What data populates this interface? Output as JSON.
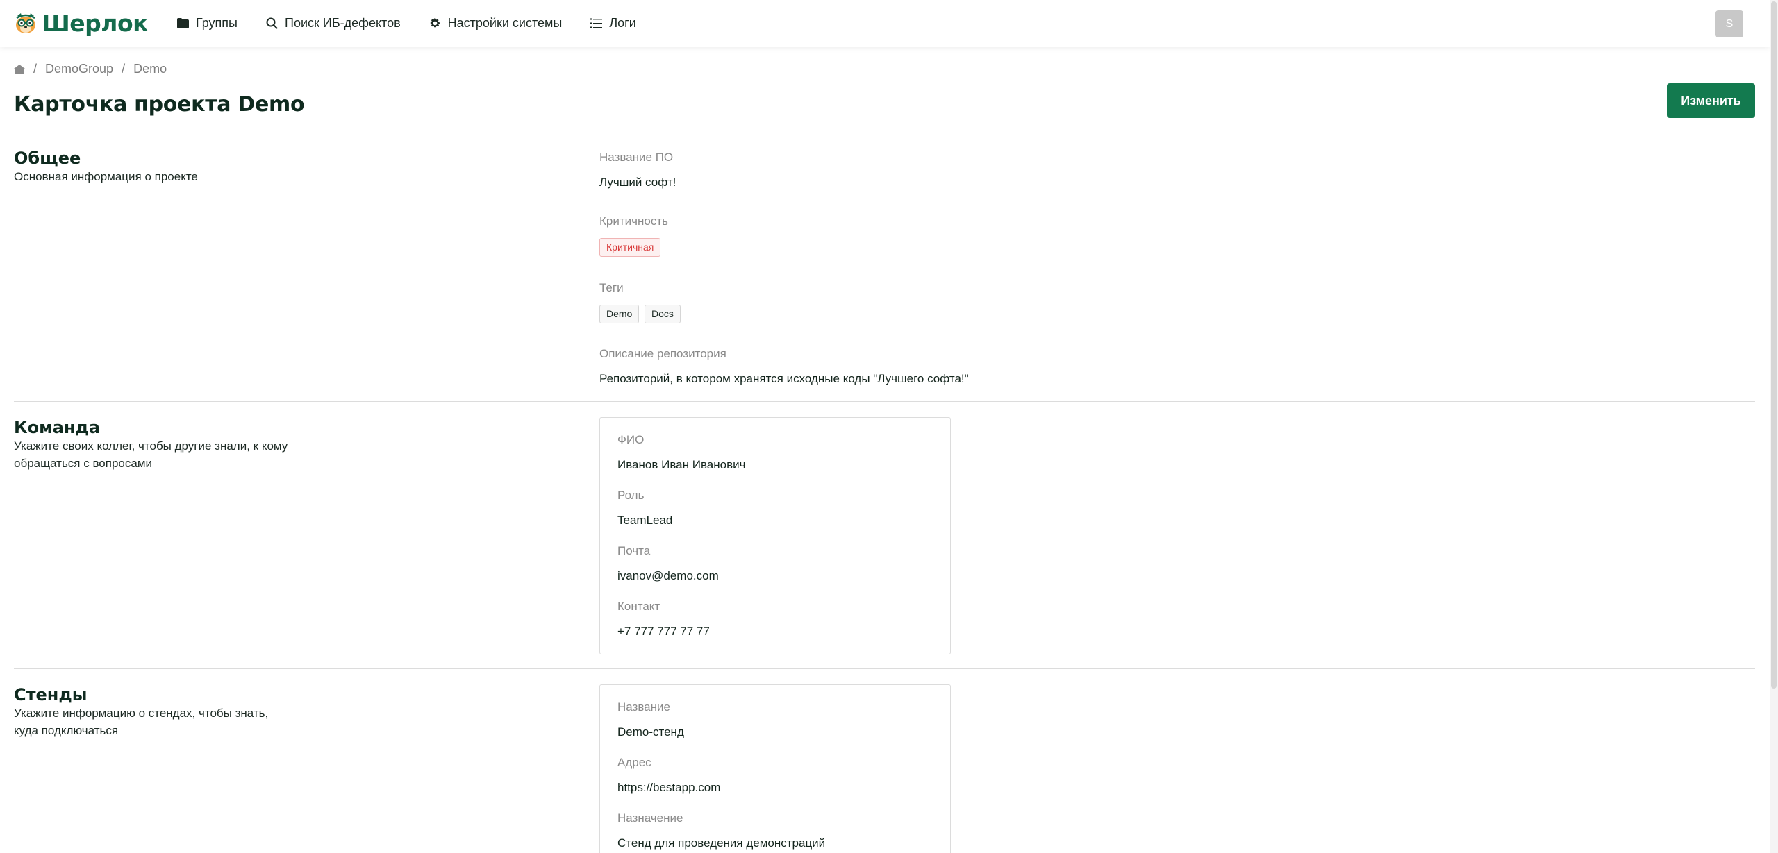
{
  "brand": {
    "name": "Шерлок"
  },
  "nav": {
    "groups": "Группы",
    "search": "Поиск ИБ-дефектов",
    "settings": "Настройки системы",
    "logs": "Логи"
  },
  "user": {
    "avatar_letter": "S"
  },
  "breadcrumb": {
    "group": "DemoGroup",
    "project": "Demo",
    "separator": "/"
  },
  "page": {
    "title": "Карточка проекта Demo",
    "edit_label": "Изменить"
  },
  "general": {
    "title": "Общее",
    "description": "Основная информация о проекте",
    "software_label": "Название ПО",
    "software_value": "Лучший софт!",
    "criticality_label": "Критичность",
    "criticality_value": "Критичная",
    "tags_label": "Теги",
    "tags": [
      "Demo",
      "Docs"
    ],
    "repo_label": "Описание репозитория",
    "repo_value": "Репозиторий, в котором хранятся исходные коды \"Лучшего софта!\""
  },
  "team": {
    "title": "Команда",
    "description": "Укажите своих коллег, чтобы другие знали, к кому обращаться с вопросами",
    "name_label": "ФИО",
    "name_value": "Иванов Иван Иванович",
    "role_label": "Роль",
    "role_value": "TeamLead",
    "email_label": "Почта",
    "email_value": "ivanov@demo.com",
    "contact_label": "Контакт",
    "contact_value": "+7 777 777 77 77"
  },
  "stands": {
    "title": "Стенды",
    "description": "Укажите информацию о стендах, чтобы знать, куда подключаться",
    "name_label": "Название",
    "name_value": "Demo-стенд",
    "address_label": "Адрес",
    "address_value": "https://bestapp.com",
    "purpose_label": "Назначение",
    "purpose_value": "Стенд для проведения демонстраций"
  }
}
